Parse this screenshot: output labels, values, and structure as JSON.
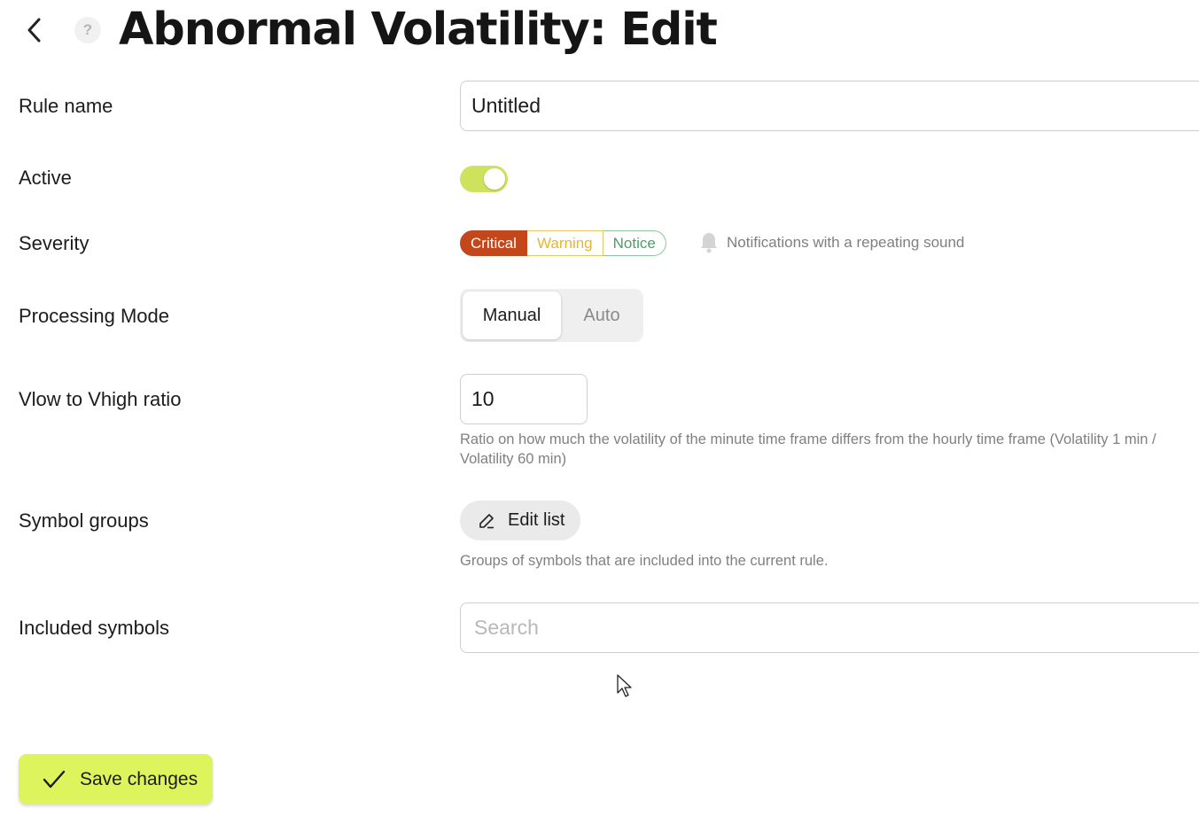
{
  "header": {
    "help_glyph": "?",
    "title": "Abnormal Volatility: Edit"
  },
  "fields": {
    "rule_name": {
      "label": "Rule name",
      "value": "Untitled"
    },
    "active": {
      "label": "Active",
      "on": true,
      "color_on": "#cfe25e"
    },
    "severity": {
      "label": "Severity",
      "options": [
        "Critical",
        "Warning",
        "Notice"
      ],
      "selected": "Critical",
      "colors": {
        "critical": "#c4471c",
        "warning": "#e8b52e",
        "notice": "#49a063"
      },
      "notification_text": "Notifications with a repeating sound"
    },
    "processing_mode": {
      "label": "Processing Mode",
      "options": [
        "Manual",
        "Auto"
      ],
      "selected": "Manual"
    },
    "ratio": {
      "label": "Vlow to Vhigh ratio",
      "value": "10",
      "hint": "Ratio on how much the volatility of the minute time frame differs from the hourly time frame (Volatility 1 min / Volatility 60 min)"
    },
    "symbol_groups": {
      "label": "Symbol groups",
      "button_label": "Edit list",
      "hint": "Groups of symbols that are included into the current rule."
    },
    "included_symbols": {
      "label": "Included symbols",
      "placeholder": "Search"
    }
  },
  "footer": {
    "save_label": "Save changes",
    "save_color": "#def45c"
  },
  "icons": [
    "back-arrow-icon",
    "help-icon",
    "bell-icon",
    "pencil-icon",
    "check-icon",
    "mouse-cursor-icon"
  ]
}
